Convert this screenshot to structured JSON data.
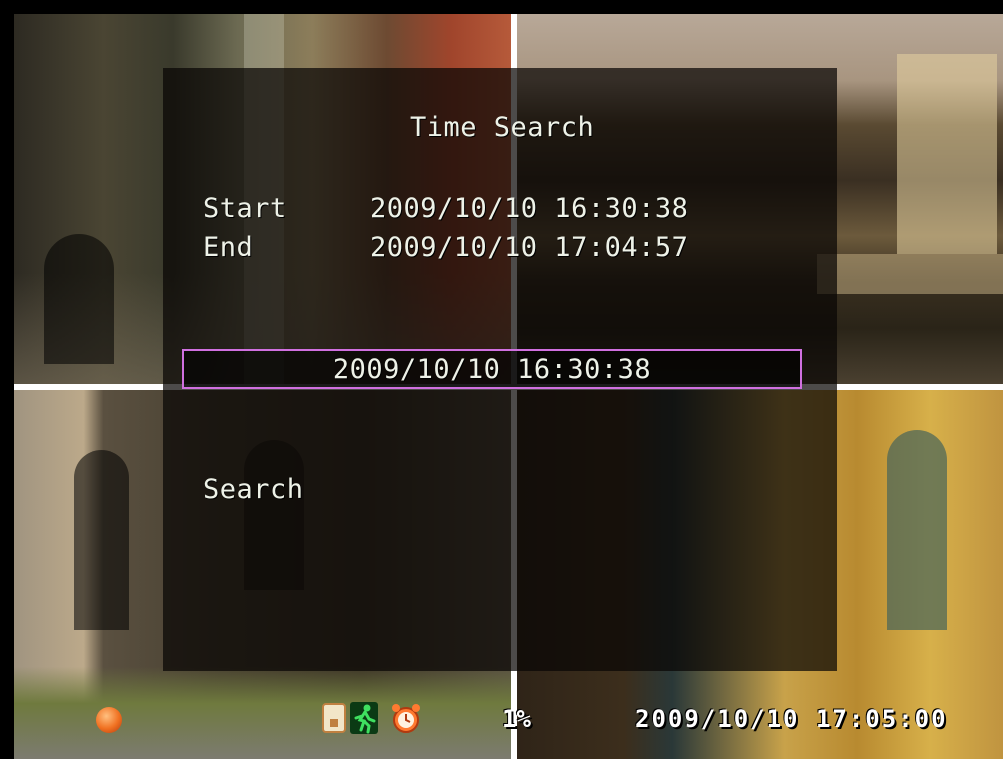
{
  "dialog": {
    "title": "Time Search",
    "start_label": "Start",
    "start_value": "2009/10/10 16:30:38",
    "end_label": "End",
    "end_value": "2009/10/10 17:04:57",
    "search_time_value": "2009/10/10 16:30:38",
    "search_button": "Search"
  },
  "status_bar": {
    "record_icon": "record-status-icon",
    "icons": [
      "hdd-icon",
      "motion-icon",
      "alarm-clock-icon"
    ],
    "disk_usage": "1%",
    "clock": "2009/10/10 17:05:00"
  },
  "colors": {
    "overlay": "#080604",
    "field_border": "#d070e0",
    "text": "#eef2e8",
    "divider": "#ffffff"
  }
}
